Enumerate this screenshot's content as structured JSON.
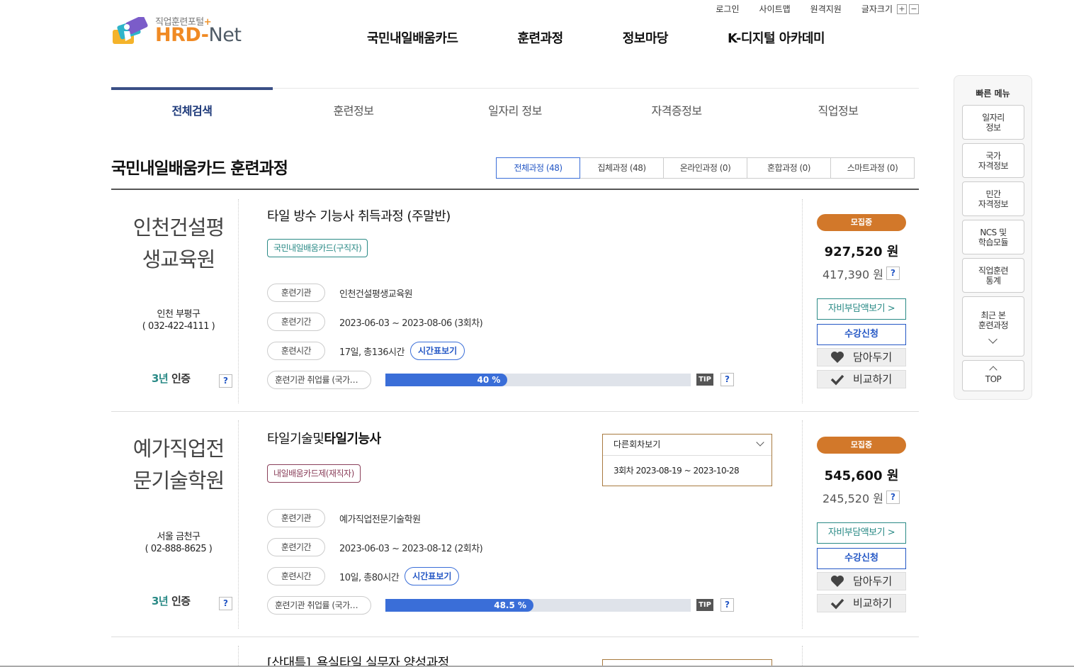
{
  "header": {
    "logo_sub": "직업훈련포털",
    "logo_plus": "+",
    "logo_main": "HRD-",
    "logo_net": "Net",
    "util": [
      "로그인",
      "사이트맵",
      "원격지원"
    ],
    "font_size_label": "글자크기",
    "font_plus": "+",
    "font_minus": "−",
    "gnb": [
      "국민내일배움카드",
      "훈련과정",
      "정보마당",
      "K-디지털 아카데미"
    ]
  },
  "tabs": [
    "전체검색",
    "훈련정보",
    "일자리 정보",
    "자격증정보",
    "직업정보"
  ],
  "page_title": "국민내일배움카드 훈련과정",
  "filters": [
    "전체과정 (48)",
    "집체과정 (48)",
    "온라인과정 (0)",
    "혼합과정 (0)",
    "스마트과정 (0)"
  ],
  "labels": {
    "institution": "훈련기관",
    "period": "훈련기간",
    "hours": "훈련시간",
    "employment": "훈련기관 취업률 (국가…",
    "time_btn": "시간표보기",
    "tip": "TIP",
    "q": "?",
    "cert_year": "3년",
    "cert_text": "인증",
    "self_pay": "자비부담액보기 >",
    "apply": "수강신청",
    "save": "담아두기",
    "compare": "비교하기",
    "other_rounds": "다른회차보기"
  },
  "courses": [
    {
      "inst_line1": "인천건설평",
      "inst_line2": "생교육원",
      "location": "인천 부평구",
      "phone": "( 032-422-4111 )",
      "title_plain": "타일 방수 기능사 취득과정 (주말반)",
      "title_bold": "",
      "tag": "국민내일배움카드(구직자)",
      "institution": "인천건설평생교육원",
      "period": "2023-06-03 ~ 2023-08-06 (3회차)",
      "hours": "17일, 총136시간",
      "employment_rate": 40,
      "employment_text": "40 %",
      "status": "모집중",
      "price": "927,520 원",
      "self_price": "417,390 원"
    },
    {
      "inst_line1": "예가직업전",
      "inst_line2": "문기술학원",
      "location": "서울 금천구",
      "phone": "( 02-888-8625 )",
      "title_plain": "타일기술및",
      "title_bold": "타일기능사",
      "tag": "내일배움카드제(재직자)",
      "institution": "예가직업전문기술학원",
      "period": "2023-06-03 ~ 2023-08-12 (2회차)",
      "hours": "10일, 총80시간",
      "employment_rate": 48.5,
      "employment_text": "48.5 %",
      "other_round": "3회차 2023-08-19 ~ 2023-10-28",
      "status": "모집중",
      "price": "545,600 원",
      "self_price": "245,520 원"
    },
    {
      "title_plain": "[산대특]_욕실타일 실무자 양성과정"
    }
  ],
  "quick_menu": {
    "title": "빠른 메뉴",
    "items": [
      [
        "일자리",
        "정보"
      ],
      [
        "국가",
        "자격정보"
      ],
      [
        "민간",
        "자격정보"
      ],
      [
        "NCS 및",
        "학습모듈"
      ],
      [
        "직업훈련",
        "통계"
      ],
      [
        "최근 본",
        "훈련과정"
      ]
    ],
    "top": "TOP"
  },
  "colors": {
    "accent_blue": "#3a6ed8",
    "status_orange": "#d2782a",
    "teal": "#2a8a86",
    "logo_orange": "#f08a24"
  }
}
